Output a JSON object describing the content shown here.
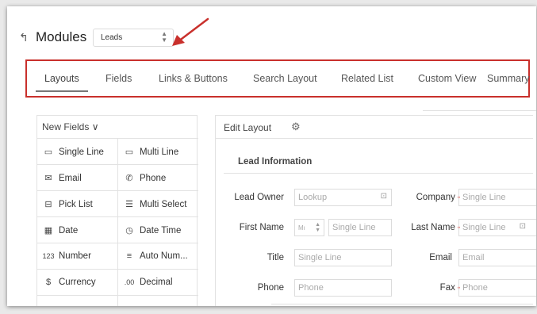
{
  "header": {
    "back_glyph": "↰",
    "title": "Modules",
    "module_select": {
      "value": "Leads"
    }
  },
  "tabs": [
    {
      "label": "Layouts",
      "active": true
    },
    {
      "label": "Fields"
    },
    {
      "label": "Links & Buttons"
    },
    {
      "label": "Search Layout"
    },
    {
      "label": "Related List"
    },
    {
      "label": "Custom View"
    },
    {
      "label": "Summary"
    }
  ],
  "new_fields": {
    "label": "New Fields",
    "chevron": "∨",
    "items": [
      {
        "label": "Single Line",
        "icon": "single-line-icon",
        "glyph": "▭"
      },
      {
        "label": "Multi Line",
        "icon": "multi-line-icon",
        "glyph": "▭"
      },
      {
        "label": "Email",
        "icon": "email-icon",
        "glyph": "✉"
      },
      {
        "label": "Phone",
        "icon": "phone-icon",
        "glyph": "✆"
      },
      {
        "label": "Pick List",
        "icon": "picklist-icon",
        "glyph": "⊟"
      },
      {
        "label": "Multi Select",
        "icon": "multi-select-icon",
        "glyph": "☰"
      },
      {
        "label": "Date",
        "icon": "date-icon",
        "glyph": "▦"
      },
      {
        "label": "Date Time",
        "icon": "date-time-icon",
        "glyph": "◷"
      },
      {
        "label": "Number",
        "icon": "number-icon",
        "glyph": "123"
      },
      {
        "label": "Auto Num...",
        "icon": "auto-number-icon",
        "glyph": "≡"
      },
      {
        "label": "Currency",
        "icon": "currency-icon",
        "glyph": "$"
      },
      {
        "label": "Decimal",
        "icon": "decimal-icon",
        "glyph": ".00"
      }
    ]
  },
  "edit_layout": {
    "label": "Edit Layout",
    "settings_glyph": "⚙",
    "section_title": "Lead Information",
    "fields": {
      "lead_owner": {
        "label": "Lead Owner",
        "placeholder": "Lookup"
      },
      "company": {
        "label": "Company",
        "placeholder": "Single Line"
      },
      "first_name": {
        "label": "First Name",
        "salutation": "Mı",
        "placeholder": "Single Line"
      },
      "last_name": {
        "label": "Last Name",
        "placeholder": "Single Line"
      },
      "title": {
        "label": "Title",
        "placeholder": "Single Line"
      },
      "email": {
        "label": "Email",
        "placeholder": "Email"
      },
      "phone": {
        "label": "Phone",
        "placeholder": "Phone"
      },
      "fax": {
        "label": "Fax",
        "placeholder": "Phone"
      }
    },
    "required_mark": "•",
    "lock_glyph": "🔒"
  },
  "annotation": {
    "arrow_color": "#c9302c"
  }
}
